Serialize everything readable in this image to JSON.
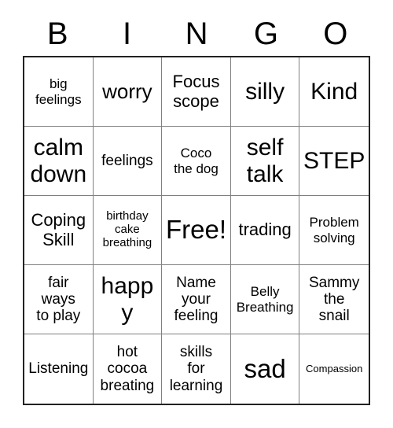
{
  "card": {
    "title": "BINGO",
    "header_letters": [
      "B",
      "I",
      "N",
      "G",
      "O"
    ],
    "free_space_label": "Free!",
    "colors": {
      "background": "#ffffff",
      "text": "#000000",
      "outer_border": "#222222",
      "grid_line": "#808080"
    },
    "grid": {
      "columns": 5,
      "rows": 5,
      "cells": [
        {
          "text": "big\nfeelings",
          "size": "fs-m"
        },
        {
          "text": "worry",
          "size": "fs-xl"
        },
        {
          "text": "Focus\nscope",
          "size": "fs-l"
        },
        {
          "text": "silly",
          "size": "fs-xxl"
        },
        {
          "text": "Kind",
          "size": "fs-xxl"
        },
        {
          "text": "calm\ndown",
          "size": "fs-xxl"
        },
        {
          "text": "feelings",
          "size": "fs-ml"
        },
        {
          "text": "Coco\nthe dog",
          "size": "fs-m"
        },
        {
          "text": "self\ntalk",
          "size": "fs-xxl"
        },
        {
          "text": "STEP",
          "size": "fs-xxl"
        },
        {
          "text": "Coping\nSkill",
          "size": "fs-l"
        },
        {
          "text": "birthday\ncake\nbreathing",
          "size": "fs-s"
        },
        {
          "text": "Free!",
          "size": "fs-huge"
        },
        {
          "text": "trading",
          "size": "fs-l"
        },
        {
          "text": "Problem\nsolving",
          "size": "fs-m"
        },
        {
          "text": "fair\nways\nto play",
          "size": "fs-ml"
        },
        {
          "text": "happy",
          "size": "fs-xxl"
        },
        {
          "text": "Name\nyour\nfeeling",
          "size": "fs-ml"
        },
        {
          "text": "Belly\nBreathing",
          "size": "fs-m"
        },
        {
          "text": "Sammy\nthe\nsnail",
          "size": "fs-ml"
        },
        {
          "text": "Listening",
          "size": "fs-ml"
        },
        {
          "text": "hot\ncocoa\nbreating",
          "size": "fs-ml"
        },
        {
          "text": "skills\nfor\nlearning",
          "size": "fs-ml"
        },
        {
          "text": "sad",
          "size": "fs-huge"
        },
        {
          "text": "Compassion",
          "size": "fs-xs"
        }
      ]
    }
  }
}
